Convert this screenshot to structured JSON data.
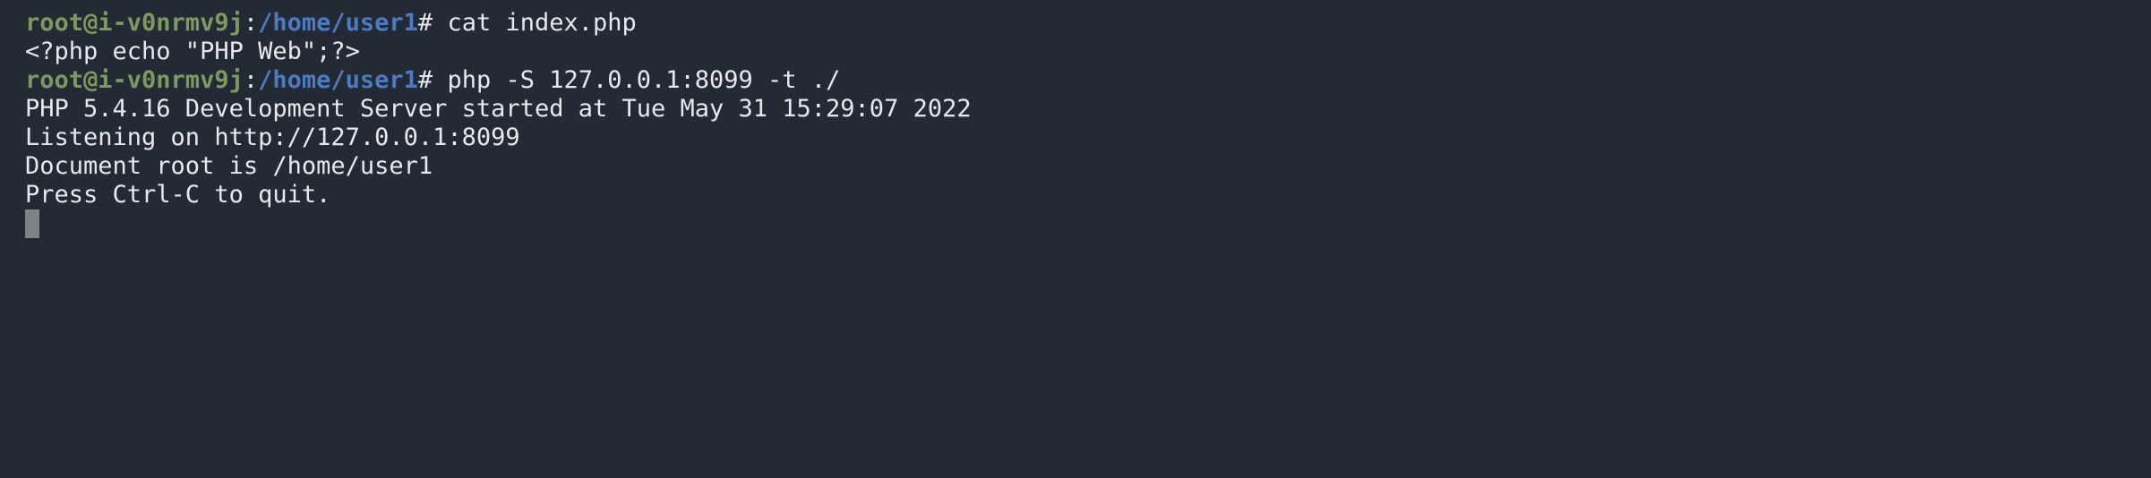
{
  "terminal": {
    "lines": [
      {
        "type": "prompt",
        "user": "root@i-v0nrmv9j",
        "separator": ":",
        "path": "/home/user1",
        "symbol": "#",
        "command": " cat index.php"
      },
      {
        "type": "output",
        "text": "<?php echo \"PHP Web\";?>"
      },
      {
        "type": "prompt",
        "user": "root@i-v0nrmv9j",
        "separator": ":",
        "path": "/home/user1",
        "symbol": "#",
        "command": " php -S 127.0.0.1:8099 -t ./"
      },
      {
        "type": "output",
        "text": "PHP 5.4.16 Development Server started at Tue May 31 15:29:07 2022"
      },
      {
        "type": "output",
        "text": "Listening on http://127.0.0.1:8099"
      },
      {
        "type": "output",
        "text": "Document root is /home/user1"
      },
      {
        "type": "output",
        "text": "Press Ctrl-C to quit."
      }
    ]
  },
  "colors": {
    "background": "#242a35",
    "user": "#7c9a5f",
    "path": "#4b7bc0",
    "text": "#e6e8eb",
    "cursor": "#7a8487"
  }
}
